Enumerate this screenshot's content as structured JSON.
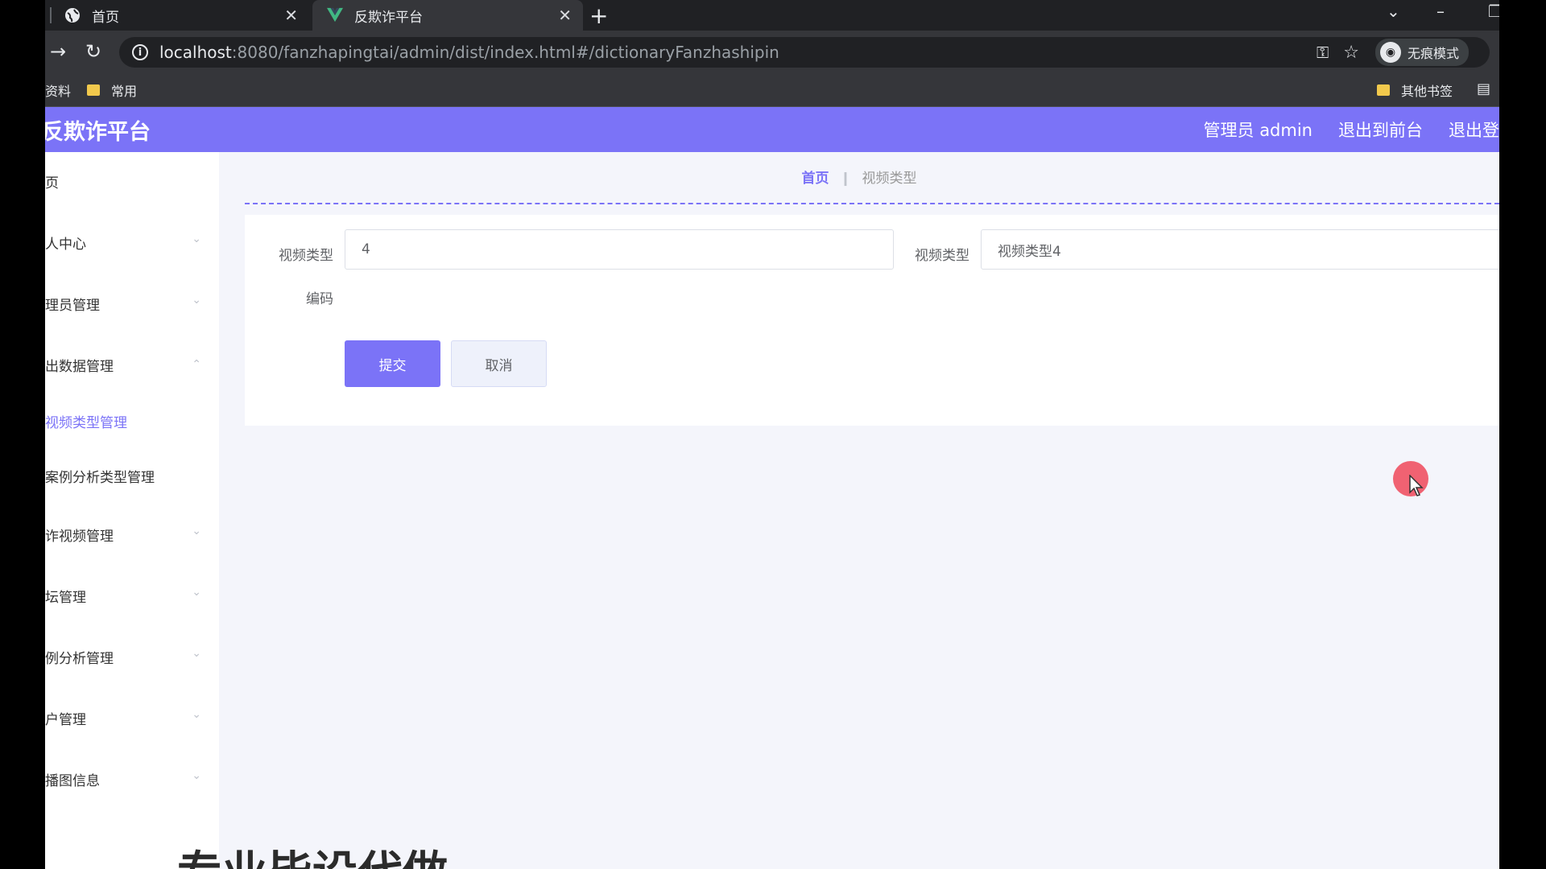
{
  "browser": {
    "tabs": [
      {
        "title": "首页",
        "icon": "globe-icon"
      },
      {
        "title": "反欺诈平台",
        "icon": "vue-logo-icon"
      }
    ],
    "new_tab": "+",
    "url": {
      "host": "localhost",
      "path": ":8080/fanzhapingtai/admin/dist/index.html#/dictionaryFanzhashipin"
    },
    "incognito_label": "无痕模式",
    "bookmarks": {
      "left_partial": "资料",
      "common": "常用",
      "other": "其他书签"
    }
  },
  "header": {
    "title": "反欺诈平台",
    "admin": "管理员 admin",
    "to_front": "退出到前台",
    "logout": "退出登"
  },
  "sidebar": {
    "items": [
      {
        "label": "页"
      },
      {
        "label": "人中心"
      },
      {
        "label": "理员管理"
      },
      {
        "label": "出数据管理"
      },
      {
        "label": "视频类型管理"
      },
      {
        "label": "案例分析类型管理"
      },
      {
        "label": "诈视频管理"
      },
      {
        "label": "坛管理"
      },
      {
        "label": "例分析管理"
      },
      {
        "label": "户管理"
      },
      {
        "label": "播图信息"
      }
    ]
  },
  "breadcrumb": {
    "home": "首页",
    "current": "视频类型"
  },
  "form": {
    "label1": "视频类型",
    "label1b": "编码",
    "value1": "4",
    "label2": "视频类型",
    "value2": "视频类型4",
    "submit": "提交",
    "cancel": "取消"
  },
  "overlay_text": "专业毕设代做",
  "colors": {
    "accent": "#7b73f7",
    "cursor": "#ef5a6a"
  }
}
